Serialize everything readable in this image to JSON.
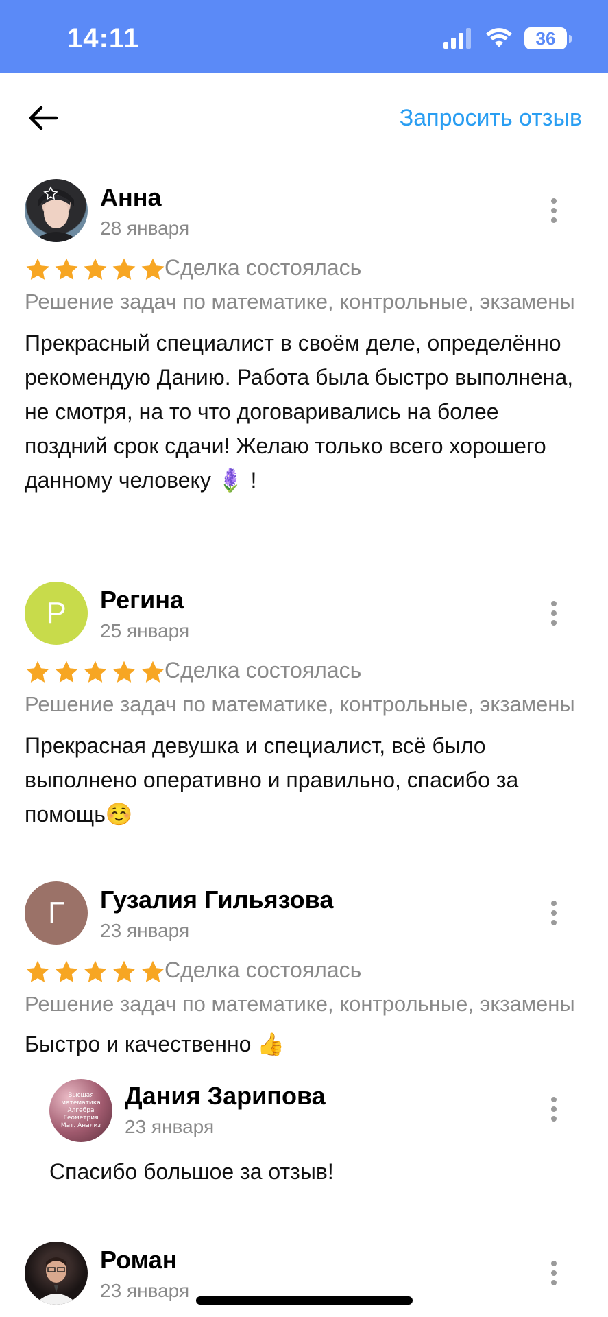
{
  "status_bar": {
    "time": "14:11",
    "battery": "36"
  },
  "header": {
    "request_review_label": "Запросить отзыв"
  },
  "reviews": [
    {
      "name": "Анна",
      "date": "28 января",
      "rating": 5,
      "deal_status": "Сделка состоялась",
      "service": "Решение задач по математике, контрольные, экзамены",
      "text": "Прекрасный специалист в своём деле, определённо рекомендую Данию. Работа была быстро выполнена, не смотря, на то что договаривались на более поздний срок сдачи! Желаю только всего хорошего данному человеку 🪻 !"
    },
    {
      "name": "Регина",
      "date": "25 января",
      "avatar_letter": "Р",
      "avatar_color": "#c8db4b",
      "rating": 5,
      "deal_status": "Сделка состоялась",
      "service": "Решение задач по математике, контрольные, экзамены",
      "text": "Прекрасная девушка и специалист, всё было выполнено оперативно и правильно, спасибо за помощь☺️"
    },
    {
      "name": "Гузалия Гильязова",
      "date": "23 января",
      "avatar_letter": "Г",
      "avatar_color": "#9b7268",
      "rating": 5,
      "deal_status": "Сделка состоялась",
      "service": "Решение задач по математике, контрольные, экзамены",
      "text": "Быстро и качественно 👍",
      "reply": {
        "name": "Дания Зарипова",
        "date": "23 января",
        "avatar_text": [
          "Высшая математика",
          "Алгебра",
          "Геометрия",
          "Мат. Анализ"
        ],
        "text": "Спасибо большое за отзыв!"
      }
    },
    {
      "name": "Роман",
      "date": "23 января"
    }
  ],
  "colors": {
    "status_bar": "#5b8af7",
    "link": "#2a9ef2",
    "star": "#f7a623",
    "muted_text": "#8a8a8a"
  }
}
